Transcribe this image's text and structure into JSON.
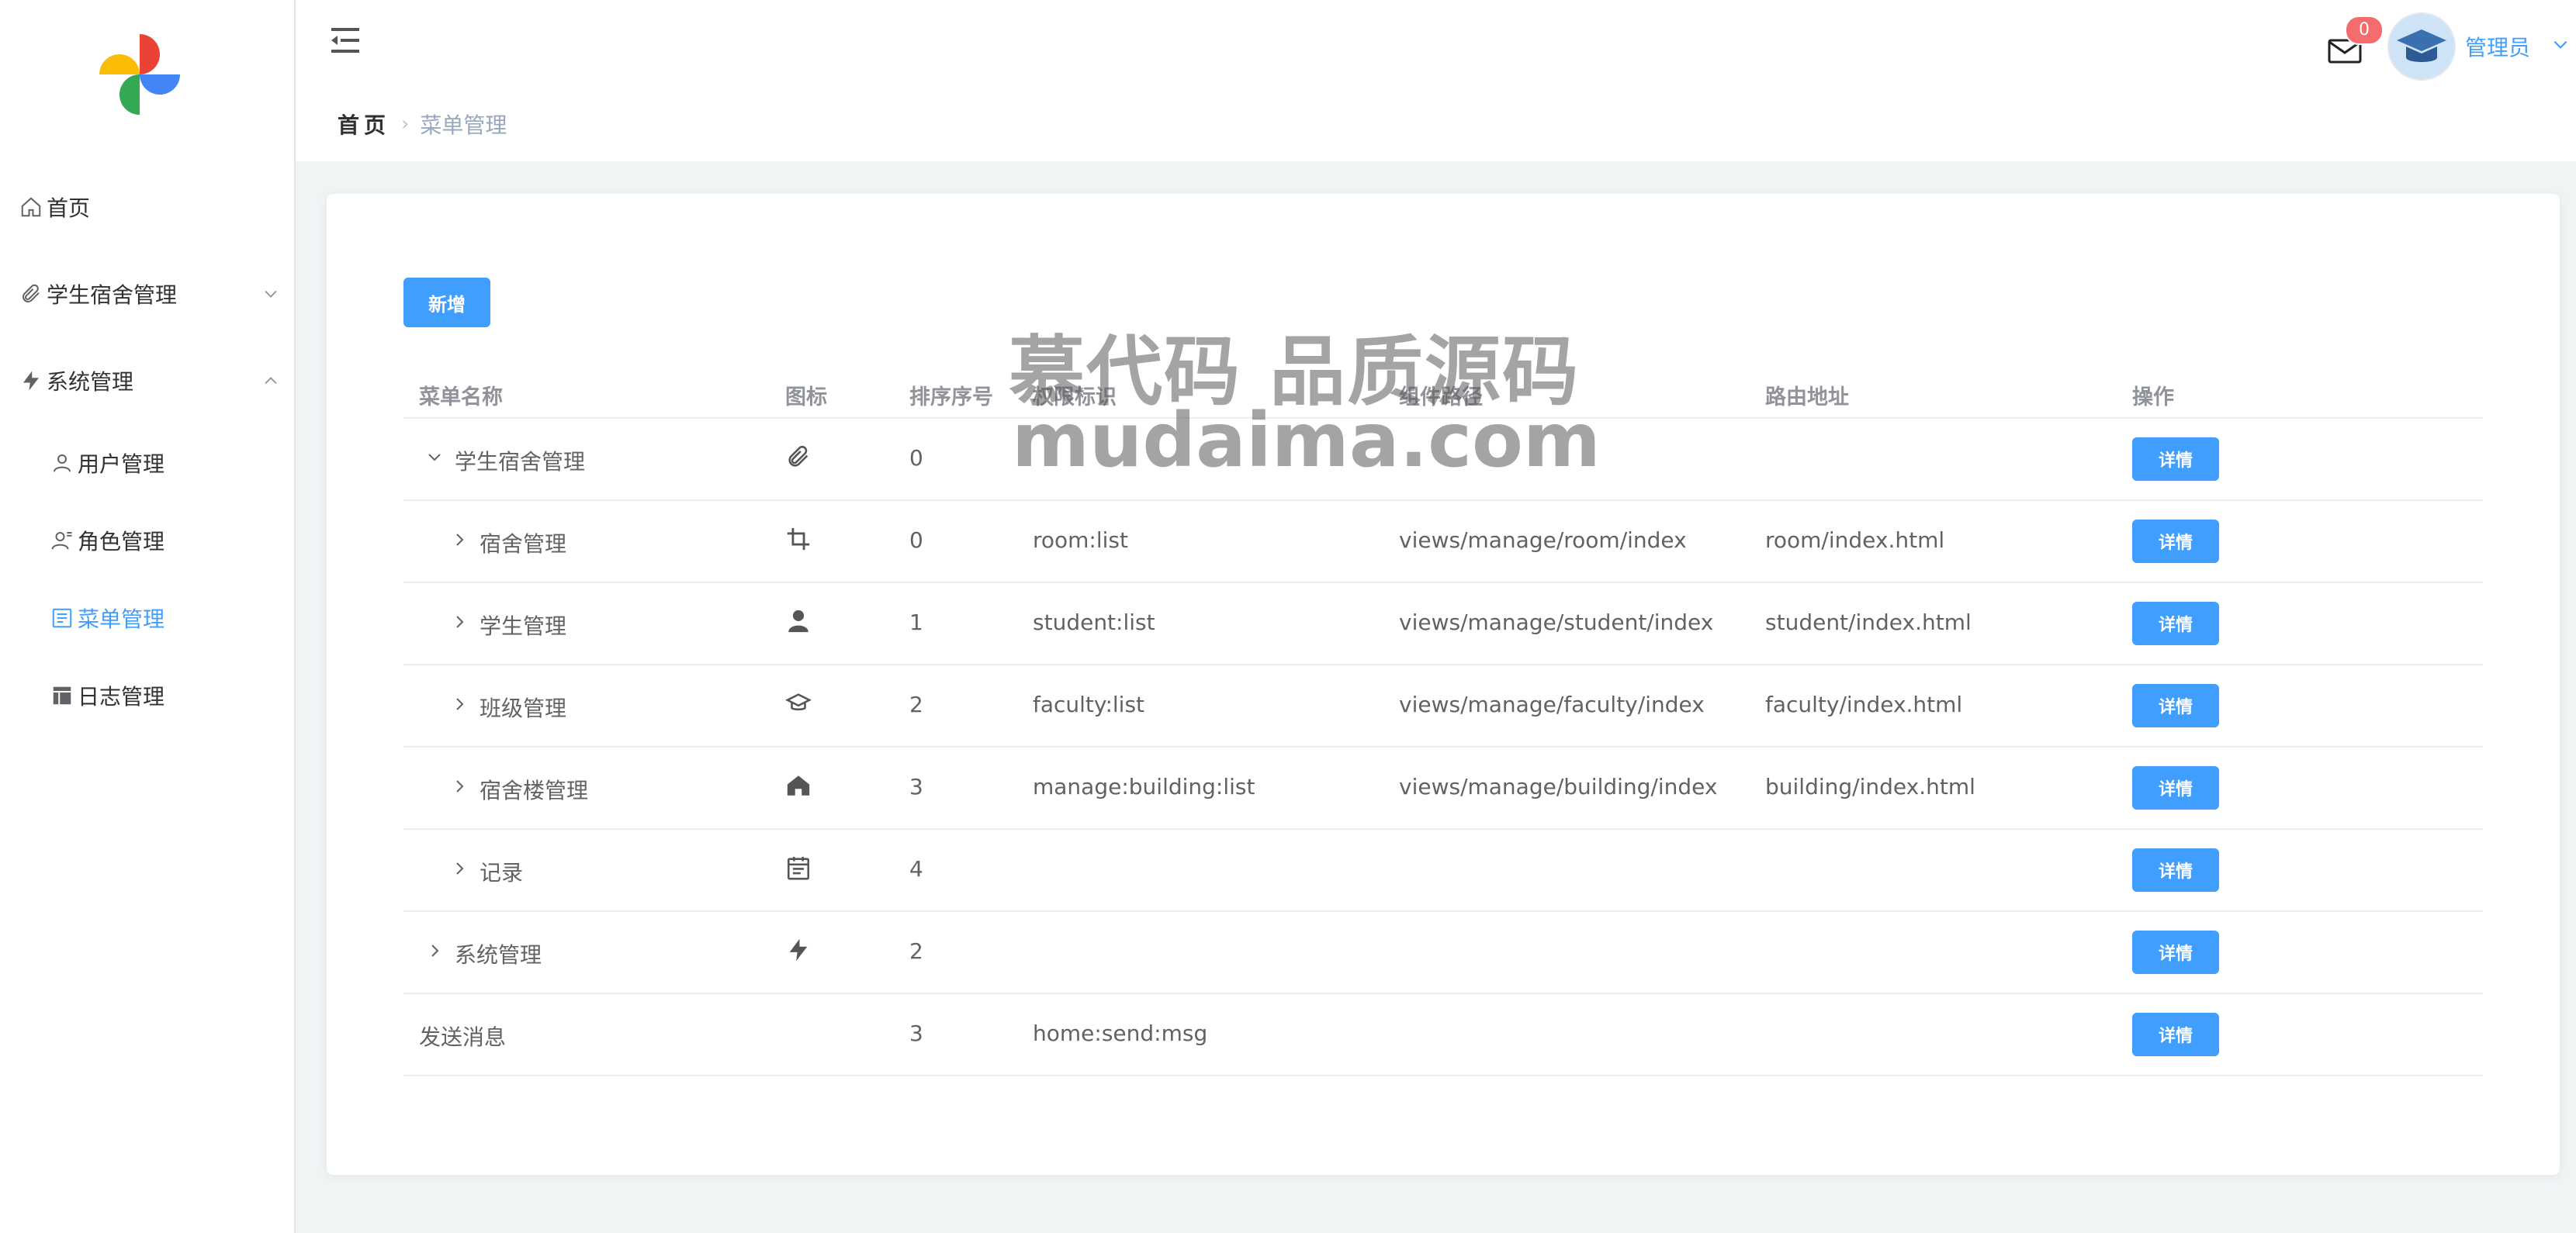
{
  "sidebar": {
    "items": [
      {
        "label": "首页",
        "icon": "home-icon"
      },
      {
        "label": "学生宿舍管理",
        "icon": "paperclip-icon"
      },
      {
        "label": "系统管理",
        "icon": "lightning-icon"
      },
      {
        "label": "用户管理",
        "icon": "user-icon"
      },
      {
        "label": "角色管理",
        "icon": "role-icon"
      },
      {
        "label": "菜单管理",
        "icon": "menu-list-icon"
      },
      {
        "label": "日志管理",
        "icon": "table-icon"
      }
    ],
    "active_color": "#409eff"
  },
  "header": {
    "breadcrumb_home": "首页",
    "breadcrumb_current": "菜单管理",
    "message_count": "0",
    "username": "管理员"
  },
  "toolbar": {
    "add_label": "新增"
  },
  "table": {
    "headers": [
      "菜单名称",
      "图标",
      "排序序号",
      "权限标识",
      "组件路径",
      "路由地址",
      "操作"
    ],
    "rows": [
      {
        "name": "学生宿舍管理",
        "icon": "paperclip-icon",
        "order": "0",
        "perm": "",
        "component": "",
        "route": "",
        "action": "详情"
      },
      {
        "name": "宿舍管理",
        "icon": "crop-icon",
        "order": "0",
        "perm": "room:list",
        "component": "views/manage/room/index",
        "route": "room/index.html",
        "action": "详情"
      },
      {
        "name": "学生管理",
        "icon": "person-icon",
        "order": "1",
        "perm": "student:list",
        "component": "views/manage/student/index",
        "route": "student/index.html",
        "action": "详情"
      },
      {
        "name": "班级管理",
        "icon": "graduation-cap-icon",
        "order": "2",
        "perm": "faculty:list",
        "component": "views/manage/faculty/index",
        "route": "faculty/index.html",
        "action": "详情"
      },
      {
        "name": "宿舍楼管理",
        "icon": "house-icon",
        "order": "3",
        "perm": "manage:building:list",
        "component": "views/manage/building/index",
        "route": "building/index.html",
        "action": "详情"
      },
      {
        "name": "记录",
        "icon": "calendar-icon",
        "order": "4",
        "perm": "",
        "component": "",
        "route": "",
        "action": "详情"
      },
      {
        "name": "系统管理",
        "icon": "lightning-icon",
        "order": "2",
        "perm": "",
        "component": "",
        "route": "",
        "action": "详情"
      },
      {
        "name": "发送消息",
        "icon": "",
        "order": "3",
        "perm": "home:send:msg",
        "component": "",
        "route": "",
        "action": "详情"
      }
    ]
  },
  "watermark": {
    "line1": "慕代码 品质源码",
    "line2": "mudaima.com"
  }
}
